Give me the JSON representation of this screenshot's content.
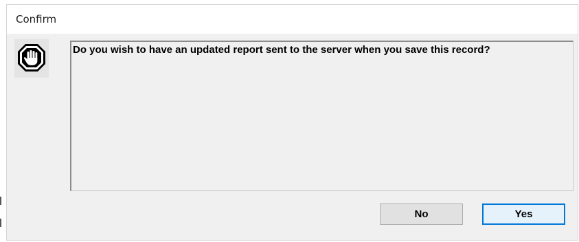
{
  "window": {
    "title": "Confirm"
  },
  "icon": {
    "name": "stop-hand-icon"
  },
  "message": {
    "text": "Do you wish to have an updated report sent to the server when you save this record?"
  },
  "buttons": {
    "no_label": "No",
    "yes_label": "Yes"
  },
  "colors": {
    "dialog_background": "#f0f0f0",
    "title_bar": "#ffffff",
    "focus_accent": "#0078d7"
  }
}
